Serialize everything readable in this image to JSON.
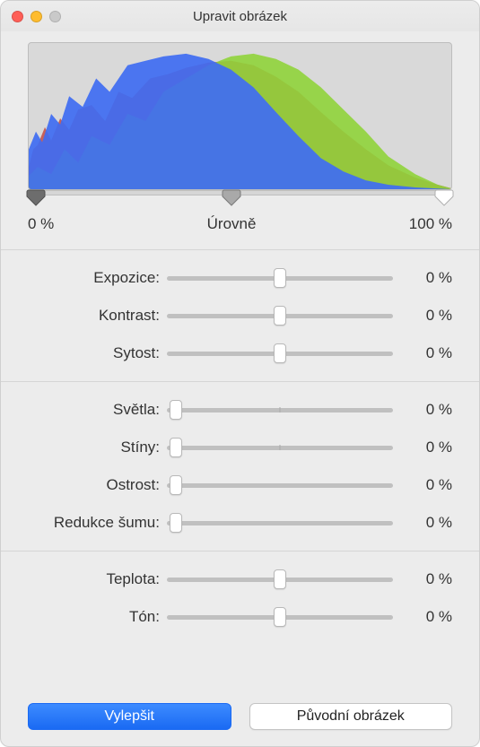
{
  "window": {
    "title": "Upravit obrázek"
  },
  "levels": {
    "label": "Úrovně",
    "min_label": "0 %",
    "max_label": "100 %",
    "black_pos": 2,
    "mid_pos": 48,
    "white_pos": 98
  },
  "groups": [
    [
      {
        "id": "exposure",
        "label": "Expozice:",
        "value": "0 %",
        "pos": 50,
        "center_tick": true
      },
      {
        "id": "contrast",
        "label": "Kontrast:",
        "value": "0 %",
        "pos": 50,
        "center_tick": true
      },
      {
        "id": "saturation",
        "label": "Sytost:",
        "value": "0 %",
        "pos": 50,
        "center_tick": true
      }
    ],
    [
      {
        "id": "highlights",
        "label": "Světla:",
        "value": "0 %",
        "pos": 4,
        "center_tick": true
      },
      {
        "id": "shadows",
        "label": "Stíny:",
        "value": "0 %",
        "pos": 4,
        "center_tick": true
      },
      {
        "id": "sharpness",
        "label": "Ostrost:",
        "value": "0 %",
        "pos": 4,
        "center_tick": false
      },
      {
        "id": "denoise",
        "label": "Redukce šumu:",
        "value": "0 %",
        "pos": 4,
        "center_tick": false
      }
    ],
    [
      {
        "id": "temperature",
        "label": "Teplota:",
        "value": "0 %",
        "pos": 50,
        "center_tick": true
      },
      {
        "id": "tint",
        "label": "Tón:",
        "value": "0 %",
        "pos": 50,
        "center_tick": true
      }
    ]
  ],
  "buttons": {
    "enhance": "Vylepšit",
    "original": "Původní obrázek"
  },
  "chart_data": {
    "type": "area",
    "title": "",
    "xlabel": "",
    "ylabel": "",
    "xlim": [
      0,
      100
    ],
    "ylim": [
      0,
      100
    ],
    "series": [
      {
        "name": "blue",
        "color": "#3a6df0"
      },
      {
        "name": "green",
        "color": "#8ed43a"
      },
      {
        "name": "red",
        "color": "#c7524b"
      }
    ],
    "note": "RGB histogram; shapes approximated visually"
  }
}
